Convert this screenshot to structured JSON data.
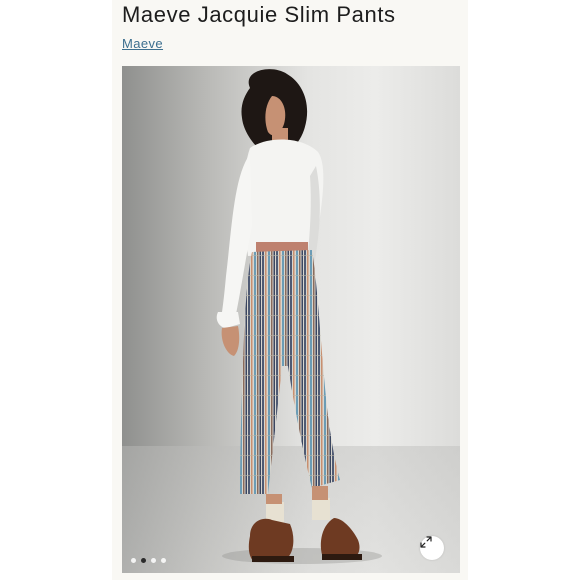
{
  "product": {
    "title": "Maeve Jacquie Slim Pants",
    "brand": "Maeve"
  },
  "gallery": {
    "image_alt": "Model wearing plaid slim pants, back view",
    "slide_count": 4,
    "active_slide": 2,
    "expand_icon": "expand-arrows-icon"
  },
  "colors": {
    "panel_background": "#f9f8f4",
    "title_text": "#1d1d1d",
    "brand_link": "#3d6f8f"
  }
}
